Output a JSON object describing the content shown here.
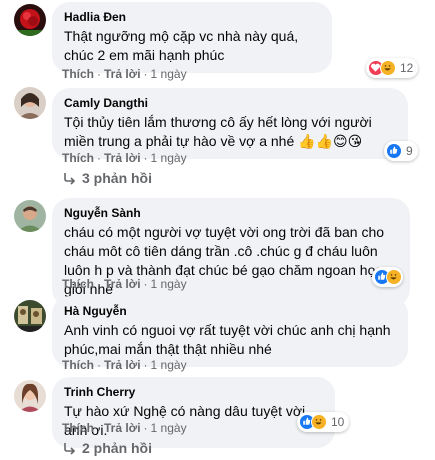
{
  "comments": [
    {
      "author": "Hadlia Đen",
      "text": "Thật ngưỡng mộ cặp vc nhà này quá, chúc 2 em mãi hạnh phúc",
      "like_label": "Thích",
      "reply_label": "Trả lời",
      "time": "1 ngày",
      "reaction_count": "12",
      "reactions": [
        "love-icon",
        "haha-icon"
      ]
    },
    {
      "author": "Camly Dangthi",
      "text": "Tội thủy tiên lắm thương cô ấy hết lòng với người miền trung a phải tự hào về vợ a nhé 👍👍😊😘",
      "like_label": "Thích",
      "reply_label": "Trả lời",
      "time": "1 ngày",
      "reaction_count": "9",
      "reactions": [
        "like-icon"
      ],
      "replies_label": "3 phản hồi"
    },
    {
      "author": "Nguyễn Sành",
      "text": "cháu có một người vợ tuyệt vời ong trời đã ban cho cháu môt cô tiên dáng trần .cô .chúc g đ cháu luôn luôn h p và thành đạt chúc bé gạo chăm ngoan học giỏi nhé",
      "like_label": "Thích",
      "reply_label": "Trả lời",
      "time": "1 ngày",
      "reaction_count": "",
      "reactions": [
        "like-icon",
        "haha-icon"
      ]
    },
    {
      "author": "Hà Nguyễn",
      "text": "Anh vinh có nguoi vợ rất tuyệt vời chúc anh chị hạnh phúc,mai mắn thật thật nhiều nhé",
      "like_label": "Thích",
      "reply_label": "Trả lời",
      "time": "1 ngày"
    },
    {
      "author": "Trinh Cherry",
      "text": "Tự hào xứ Nghệ có nàng dâu tuyệt vời anh ơi.",
      "like_label": "Thích",
      "reply_label": "Trả lời",
      "time": "1 ngày",
      "reaction_count": "10",
      "reactions": [
        "like-icon",
        "haha-icon"
      ],
      "replies_label": "2 phản hồi"
    }
  ],
  "colors": {
    "bubble": "#f0f2f5",
    "meta": "#65676b",
    "like": "#1877f2",
    "love": "#f33e58",
    "haha": "#f7b125"
  }
}
